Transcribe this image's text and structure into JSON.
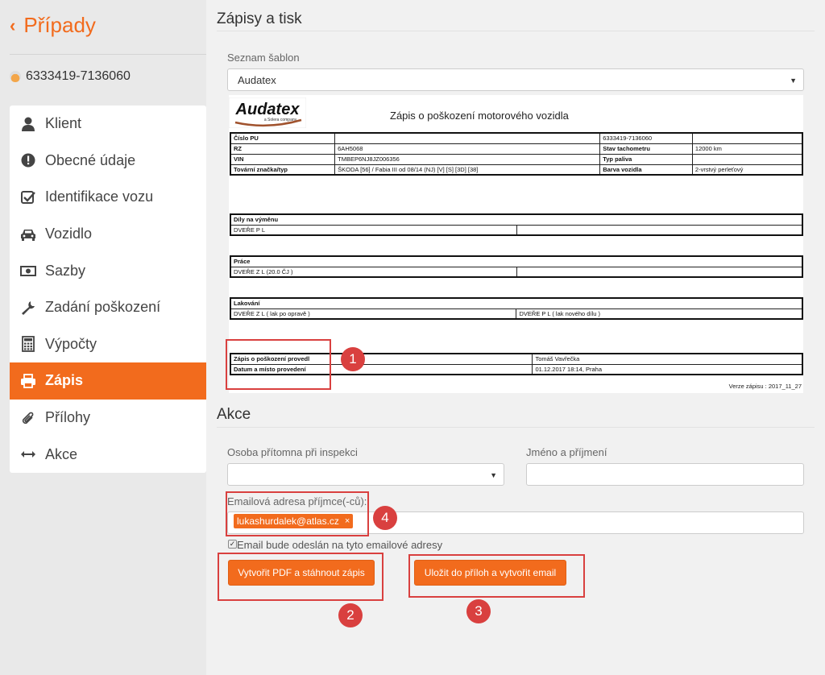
{
  "sidebar": {
    "back_label": "Případy",
    "case_id": "6333419-7136060",
    "items": [
      {
        "label": "Klient",
        "icon": "user-icon"
      },
      {
        "label": "Obecné údaje",
        "icon": "exclamation-circle-icon"
      },
      {
        "label": "Identifikace vozu",
        "icon": "check-square-icon"
      },
      {
        "label": "Vozidlo",
        "icon": "car-icon"
      },
      {
        "label": "Sazby",
        "icon": "money-icon"
      },
      {
        "label": "Zadání poškození",
        "icon": "wrench-icon"
      },
      {
        "label": "Výpočty",
        "icon": "calculator-icon"
      },
      {
        "label": "Zápis",
        "icon": "printer-icon",
        "active": true
      },
      {
        "label": "Přílohy",
        "icon": "paperclip-icon"
      },
      {
        "label": "Akce",
        "icon": "arrows-horizontal-icon"
      }
    ]
  },
  "main": {
    "title": "Zápisy a tisk",
    "template_label": "Seznam šablon",
    "template_value": "Audatex",
    "document": {
      "logo_text": "Audatex",
      "logo_sub": "a Solera company",
      "title": "Zápis o poškození motorového vozidla",
      "vehicle_rows": [
        [
          "Číslo PU",
          "",
          "6333419-7136060",
          ""
        ],
        [
          "RZ",
          "6AH5068",
          "Stav tachometru",
          "12000 km"
        ],
        [
          "VIN",
          "TMBEP6NJ8JZ006356",
          "Typ paliva",
          ""
        ],
        [
          "Tovární značka/typ",
          "ŠKODA [56] / Fabia III od 08/14 (NJ) [V] [S] [3D] [38]",
          "Barva vozidla",
          "2-vrstvý perleťový"
        ]
      ],
      "parts_header": "Díly na výměnu",
      "parts_row": [
        "DVEŘE P L",
        ""
      ],
      "work_header": "Práce",
      "work_row": [
        "DVEŘE Z L (20.0 ČJ )",
        ""
      ],
      "paint_header": "Lakování",
      "paint_row": [
        "DVEŘE Z L ( lak po opravě )",
        "DVEŘE P L ( lak nového dílu )"
      ],
      "author_rows": [
        [
          "Zápis o poškození provedl",
          "Tomáš Vavřečka"
        ],
        [
          "Datum a místo provedení",
          "01.12.2017 18:14, Praha"
        ]
      ],
      "version": "Verze zápisu : 2017_11_27"
    },
    "actions_title": "Akce",
    "person_label": "Osoba přítomna při inspekci",
    "person_value": "",
    "name_label": "Jméno a příjmení",
    "name_value": "",
    "email_label": "Emailová adresa příjmce(-ců):",
    "email_tag": "lukashurdalek@atlas.cz",
    "email_tag_remove": "×",
    "checkbox_label": "Email bude odeslán na tyto emailové adresy",
    "btn_pdf": "Vytvořit PDF a stáhnout zápis",
    "btn_save": "Uložit do příloh a vytvořit email",
    "badges": [
      "1",
      "2",
      "3",
      "4"
    ]
  },
  "colors": {
    "accent": "#f26b1d",
    "annotation_red": "#d9403f",
    "sidebar_bg": "#e9e9e9"
  }
}
